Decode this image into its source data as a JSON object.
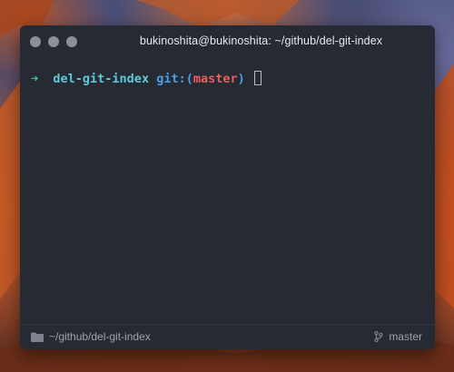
{
  "window": {
    "title": "bukinoshita@bukinoshita: ~/github/del-git-index"
  },
  "terminal": {
    "prompt_arrow": "➜",
    "directory": "del-git-index",
    "git_label": "git:",
    "paren_open": "(",
    "branch": "master",
    "paren_close": ")"
  },
  "statusbar": {
    "path": "~/github/del-git-index",
    "branch": "master"
  },
  "icons": {
    "folder": "folder-icon",
    "branch": "git-branch-icon"
  },
  "colors": {
    "window_bg": "#262a33",
    "prompt_arrow": "#3fcf8e",
    "directory": "#5fc9d6",
    "git": "#4a9ee8",
    "branch": "#ec5f5f"
  }
}
